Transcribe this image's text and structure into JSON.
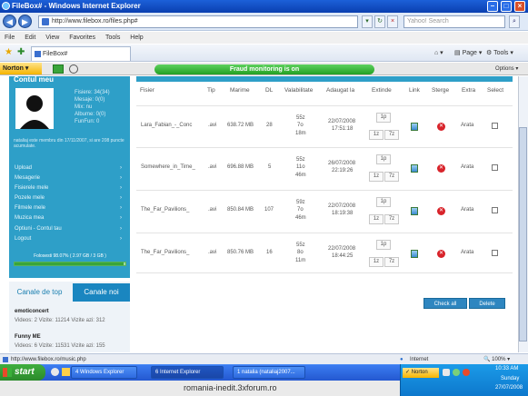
{
  "window": {
    "title": "FileBox# - Windows Internet Explorer",
    "url": "http://www.filebox.ro/files.php#",
    "search_placeholder": "Yahoo! Search",
    "tab": "FileBox#"
  },
  "menu": [
    "File",
    "Edit",
    "View",
    "Favorites",
    "Tools",
    "Help"
  ],
  "toolbar": {
    "page": "Page",
    "tools": "Tools"
  },
  "norton": {
    "label": "Norton",
    "banner": "Fraud monitoring is on",
    "options": "Options"
  },
  "sidebar": {
    "heading": "Contul meu",
    "stats": [
      "Fisiere: 34(34)",
      "Mesaje: 0(0)",
      "Mix: nu",
      "Albume: 0(0)",
      "FunFun: 0"
    ],
    "member_note": "nataliaj este membru din 17/11/2007, si are 208 puncte acumulate.",
    "menu": [
      "Upload",
      "Mesagerie",
      "Fisierele mele",
      "Pozele mele",
      "Filmele mele",
      "Muzica mea",
      "Optiuni - Contul tau",
      "Logout"
    ],
    "quota": "Folosesti 98.07% ( 2.97 GB / 3 GB )",
    "quota_fraction": 0.98,
    "tabs": {
      "new": "Canale de top",
      "top": "Canale noi"
    },
    "feeds": [
      {
        "name": "emoticoncert",
        "stats": "Videos: 2   Vizite: 11214   Vizite azi: 312"
      },
      {
        "name": "Funny ME",
        "stats": "Videos: 6   Vizite: 11531   Vizite azi: 155"
      }
    ]
  },
  "table": {
    "headers": [
      "Fisier",
      "Tip",
      "Marime",
      "DL",
      "Valabilitate",
      "Adaugat la",
      "Extinde",
      "Link",
      "Sterge",
      "Extra",
      "Select"
    ],
    "rows": [
      {
        "file": "Lara_Fabian_-_Conc",
        "type": ".avi",
        "size": "638.72 MB",
        "dl": "28",
        "valid": [
          "55z",
          "7o",
          "18m"
        ],
        "added": [
          "22/07/2008",
          "17:51:18"
        ],
        "extend": [
          "1p",
          "1z",
          "7z"
        ],
        "extra": "Arata"
      },
      {
        "file": "Somewhere_in_Time_",
        "type": ".avi",
        "size": "696.88 MB",
        "dl": "5",
        "valid": [
          "55z",
          "11o",
          "46m"
        ],
        "added": [
          "26/07/2008",
          "22:19:26"
        ],
        "extend": [
          "1p",
          "1z",
          "7z"
        ],
        "extra": "Arata"
      },
      {
        "file": "The_Far_Pavilions_",
        "type": ".avi",
        "size": "850.84 MB",
        "dl": "107",
        "valid": [
          "59z",
          "7o",
          "46m"
        ],
        "added": [
          "22/07/2008",
          "18:19:38"
        ],
        "extend": [
          "1p",
          "1z",
          "7z"
        ],
        "extra": "Arata"
      },
      {
        "file": "The_Far_Pavilions_",
        "type": ".avi",
        "size": "850.76 MB",
        "dl": "16",
        "valid": [
          "55z",
          "8o",
          "11m"
        ],
        "added": [
          "22/07/2008",
          "18:44:25"
        ],
        "extend": [
          "1p",
          "1z",
          "7z"
        ],
        "extra": "Arata"
      }
    ],
    "check_all": "Check all",
    "delete": "Delete"
  },
  "status": {
    "url": "http://www.filebox.ro/music.php",
    "zone": "Internet",
    "zoom": "100%"
  },
  "taskbar": {
    "start": "start",
    "items": [
      "4 Windows Explorer",
      "6 Internet Explorer",
      "1 natalia (nataliaj2007..."
    ],
    "norton": "Norton",
    "clock": [
      "10:33 AM",
      "Sunday",
      "27/07/2008"
    ]
  },
  "caption": "romania-inedit.3xforum.ro"
}
